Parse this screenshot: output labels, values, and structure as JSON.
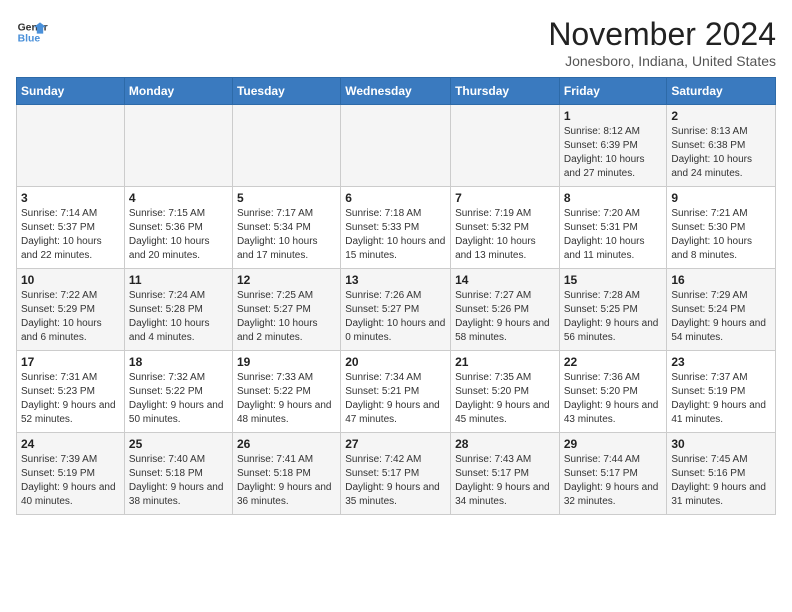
{
  "header": {
    "logo_line1": "General",
    "logo_line2": "Blue",
    "month_title": "November 2024",
    "location": "Jonesboro, Indiana, United States"
  },
  "weekdays": [
    "Sunday",
    "Monday",
    "Tuesday",
    "Wednesday",
    "Thursday",
    "Friday",
    "Saturday"
  ],
  "weeks": [
    [
      {
        "day": "",
        "info": ""
      },
      {
        "day": "",
        "info": ""
      },
      {
        "day": "",
        "info": ""
      },
      {
        "day": "",
        "info": ""
      },
      {
        "day": "",
        "info": ""
      },
      {
        "day": "1",
        "info": "Sunrise: 8:12 AM\nSunset: 6:39 PM\nDaylight: 10 hours and 27 minutes."
      },
      {
        "day": "2",
        "info": "Sunrise: 8:13 AM\nSunset: 6:38 PM\nDaylight: 10 hours and 24 minutes."
      }
    ],
    [
      {
        "day": "3",
        "info": "Sunrise: 7:14 AM\nSunset: 5:37 PM\nDaylight: 10 hours and 22 minutes."
      },
      {
        "day": "4",
        "info": "Sunrise: 7:15 AM\nSunset: 5:36 PM\nDaylight: 10 hours and 20 minutes."
      },
      {
        "day": "5",
        "info": "Sunrise: 7:17 AM\nSunset: 5:34 PM\nDaylight: 10 hours and 17 minutes."
      },
      {
        "day": "6",
        "info": "Sunrise: 7:18 AM\nSunset: 5:33 PM\nDaylight: 10 hours and 15 minutes."
      },
      {
        "day": "7",
        "info": "Sunrise: 7:19 AM\nSunset: 5:32 PM\nDaylight: 10 hours and 13 minutes."
      },
      {
        "day": "8",
        "info": "Sunrise: 7:20 AM\nSunset: 5:31 PM\nDaylight: 10 hours and 11 minutes."
      },
      {
        "day": "9",
        "info": "Sunrise: 7:21 AM\nSunset: 5:30 PM\nDaylight: 10 hours and 8 minutes."
      }
    ],
    [
      {
        "day": "10",
        "info": "Sunrise: 7:22 AM\nSunset: 5:29 PM\nDaylight: 10 hours and 6 minutes."
      },
      {
        "day": "11",
        "info": "Sunrise: 7:24 AM\nSunset: 5:28 PM\nDaylight: 10 hours and 4 minutes."
      },
      {
        "day": "12",
        "info": "Sunrise: 7:25 AM\nSunset: 5:27 PM\nDaylight: 10 hours and 2 minutes."
      },
      {
        "day": "13",
        "info": "Sunrise: 7:26 AM\nSunset: 5:27 PM\nDaylight: 10 hours and 0 minutes."
      },
      {
        "day": "14",
        "info": "Sunrise: 7:27 AM\nSunset: 5:26 PM\nDaylight: 9 hours and 58 minutes."
      },
      {
        "day": "15",
        "info": "Sunrise: 7:28 AM\nSunset: 5:25 PM\nDaylight: 9 hours and 56 minutes."
      },
      {
        "day": "16",
        "info": "Sunrise: 7:29 AM\nSunset: 5:24 PM\nDaylight: 9 hours and 54 minutes."
      }
    ],
    [
      {
        "day": "17",
        "info": "Sunrise: 7:31 AM\nSunset: 5:23 PM\nDaylight: 9 hours and 52 minutes."
      },
      {
        "day": "18",
        "info": "Sunrise: 7:32 AM\nSunset: 5:22 PM\nDaylight: 9 hours and 50 minutes."
      },
      {
        "day": "19",
        "info": "Sunrise: 7:33 AM\nSunset: 5:22 PM\nDaylight: 9 hours and 48 minutes."
      },
      {
        "day": "20",
        "info": "Sunrise: 7:34 AM\nSunset: 5:21 PM\nDaylight: 9 hours and 47 minutes."
      },
      {
        "day": "21",
        "info": "Sunrise: 7:35 AM\nSunset: 5:20 PM\nDaylight: 9 hours and 45 minutes."
      },
      {
        "day": "22",
        "info": "Sunrise: 7:36 AM\nSunset: 5:20 PM\nDaylight: 9 hours and 43 minutes."
      },
      {
        "day": "23",
        "info": "Sunrise: 7:37 AM\nSunset: 5:19 PM\nDaylight: 9 hours and 41 minutes."
      }
    ],
    [
      {
        "day": "24",
        "info": "Sunrise: 7:39 AM\nSunset: 5:19 PM\nDaylight: 9 hours and 40 minutes."
      },
      {
        "day": "25",
        "info": "Sunrise: 7:40 AM\nSunset: 5:18 PM\nDaylight: 9 hours and 38 minutes."
      },
      {
        "day": "26",
        "info": "Sunrise: 7:41 AM\nSunset: 5:18 PM\nDaylight: 9 hours and 36 minutes."
      },
      {
        "day": "27",
        "info": "Sunrise: 7:42 AM\nSunset: 5:17 PM\nDaylight: 9 hours and 35 minutes."
      },
      {
        "day": "28",
        "info": "Sunrise: 7:43 AM\nSunset: 5:17 PM\nDaylight: 9 hours and 34 minutes."
      },
      {
        "day": "29",
        "info": "Sunrise: 7:44 AM\nSunset: 5:17 PM\nDaylight: 9 hours and 32 minutes."
      },
      {
        "day": "30",
        "info": "Sunrise: 7:45 AM\nSunset: 5:16 PM\nDaylight: 9 hours and 31 minutes."
      }
    ]
  ]
}
